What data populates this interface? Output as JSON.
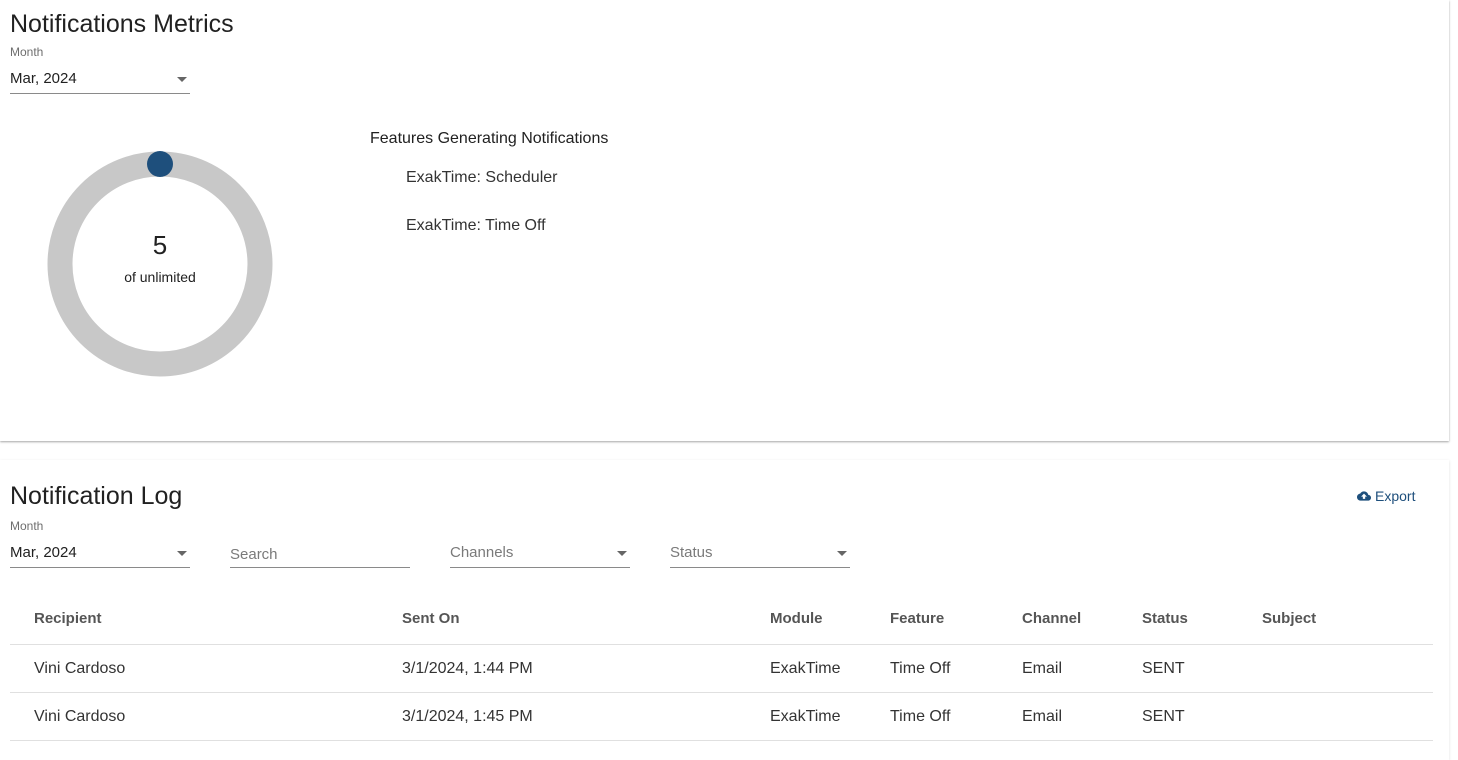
{
  "metrics": {
    "title": "Notifications Metrics",
    "month_label": "Month",
    "month_value": "Mar, 2024",
    "donut": {
      "value": "5",
      "subtitle": "of unlimited",
      "ring_color": "#c8c8c8",
      "dot_color": "#1e4f7c"
    },
    "features_title": "Features Generating Notifications",
    "features": [
      "ExakTime: Scheduler",
      "ExakTime: Time Off"
    ]
  },
  "log": {
    "title": "Notification Log",
    "export_label": "Export",
    "export_icon": "cloud-upload-icon",
    "month_label": "Month",
    "month_value": "Mar, 2024",
    "search_placeholder": "Search",
    "channels_placeholder": "Channels",
    "status_placeholder": "Status",
    "columns": [
      "Recipient",
      "Sent On",
      "Module",
      "Feature",
      "Channel",
      "Status",
      "Subject"
    ],
    "rows": [
      [
        "Vini Cardoso",
        "3/1/2024, 1:44 PM",
        "ExakTime",
        "Time Off",
        "Email",
        "SENT",
        ""
      ],
      [
        "Vini Cardoso",
        "3/1/2024, 1:45 PM",
        "ExakTime",
        "Time Off",
        "Email",
        "SENT",
        ""
      ]
    ]
  }
}
